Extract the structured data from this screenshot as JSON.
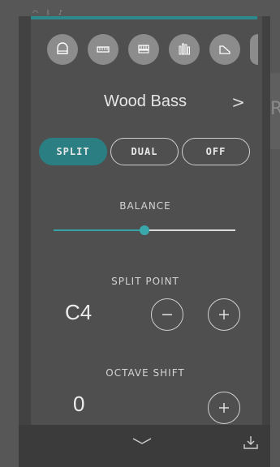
{
  "voice": {
    "name": "Wood Bass",
    "next_icon": "chevron-right-icon"
  },
  "instruments": [
    {
      "icon": "grand-piano-icon"
    },
    {
      "icon": "keyboard-icon"
    },
    {
      "icon": "organ-icon"
    },
    {
      "icon": "pipe-organ-icon"
    },
    {
      "icon": "harpsichord-icon"
    }
  ],
  "modes": [
    {
      "label": "SPLIT",
      "active": true
    },
    {
      "label": "DUAL",
      "active": false
    },
    {
      "label": "OFF",
      "active": false
    }
  ],
  "balance": {
    "label": "BALANCE",
    "value": 0.5
  },
  "split_point": {
    "label": "SPLIT POINT",
    "value": "C4"
  },
  "octave_shift": {
    "label": "OCTAVE SHIFT",
    "value": "0"
  },
  "colors": {
    "accent": "#2b7f82",
    "panel": "#4f4f4f",
    "bottom_bar": "#3b3b3b"
  }
}
